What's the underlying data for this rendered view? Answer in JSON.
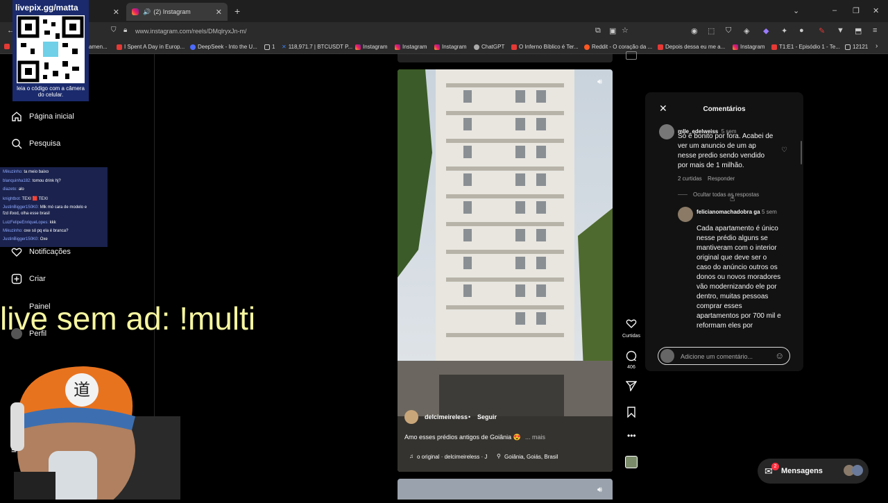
{
  "browser": {
    "tabs": [
      {
        "label": ""
      },
      {
        "label": "(2) Instagram"
      }
    ],
    "new_tab": "+",
    "url": "www.instagram.com/reels/DMqlryxJn-m/",
    "bookmarks": [
      "amen...",
      "I Spent A Day in Europ...",
      "DeepSeek - Into the U...",
      "1",
      "118,971.7 | BTCUSDT P...",
      "Instagram",
      "Instagram",
      "Instagram",
      "ChatGPT",
      "O Inferno Bíblico é Ter...",
      "Reddit - O coração da ...",
      "Depois dessa eu me a...",
      "Instagram",
      "T1:E1 - Episódio 1 - Te...",
      "12121"
    ]
  },
  "overlay": {
    "qr_title": "livepix.gg/matta",
    "qr_caption": "leia o código com a câmera do celular.",
    "big_text": "live sem ad: !multi",
    "chat": [
      {
        "user": "Mikuzinho:",
        "msg": "ta meio baixo"
      },
      {
        "user": "blanquinha182:",
        "msg": "tomou drink hj?"
      },
      {
        "user": "diazeto:",
        "msg": "alo"
      },
      {
        "user": "knightbot:",
        "msg": "TEXI 🟥 TEXI"
      },
      {
        "user": "JustinBigger150K0:",
        "msg": "Mlk mó cara de modelo e"
      },
      {
        "user": "",
        "msg": "fzd ifood, olha esse brasil"
      },
      {
        "user": "LuizFelipeEnriqueLopes:",
        "msg": "kkk"
      },
      {
        "user": "Mikuzinho:",
        "msg": "oxe só pq ela é branca?"
      },
      {
        "user": "JustinBigger150K0:",
        "msg": "Oxe"
      }
    ]
  },
  "sidebar": {
    "items": [
      {
        "label": "Página inicial"
      },
      {
        "label": "Pesquisa"
      },
      {
        "label": "Notificações"
      },
      {
        "label": "Criar"
      },
      {
        "label": "Painel"
      },
      {
        "label": "Perfil"
      }
    ]
  },
  "reel": {
    "username": "delcimeireless",
    "follow": "Seguir",
    "separator": "•",
    "caption": "Amo esses prédios antigos de Goiânia 😍",
    "more": "... mais",
    "audio": "o original · delcimeireless · J",
    "location": "Goiânia, Goiás, Brasil",
    "likes_label": "Curtidas",
    "comments_count": "406"
  },
  "comments_panel": {
    "title": "Comentários",
    "comment1": {
      "user": "mlle_edelweiss",
      "time": "5 sem",
      "text": "Só é bonito por fora. Acabei de ver um anuncio de um ap nesse predio sendo vendido por mais de 1 milhão.",
      "likes": "2 curtidas",
      "reply": "Responder",
      "hide_replies": "Ocultar todas as respostas"
    },
    "reply1": {
      "user": "felicianomachadobra ga",
      "time": "5 sem",
      "text": "Cada apartamento é único nesse prédio alguns se mantiveram com o interior original que deve ser o caso do anúncio outros os donos ou novos moradores vão modernizando ele por dentro, muitas pessoas comprar esses apartamentos por 700 mil e reformam eles por"
    },
    "input_placeholder": "Adicione um comentário..."
  },
  "messages": {
    "label": "Mensagens",
    "badge": "2"
  }
}
